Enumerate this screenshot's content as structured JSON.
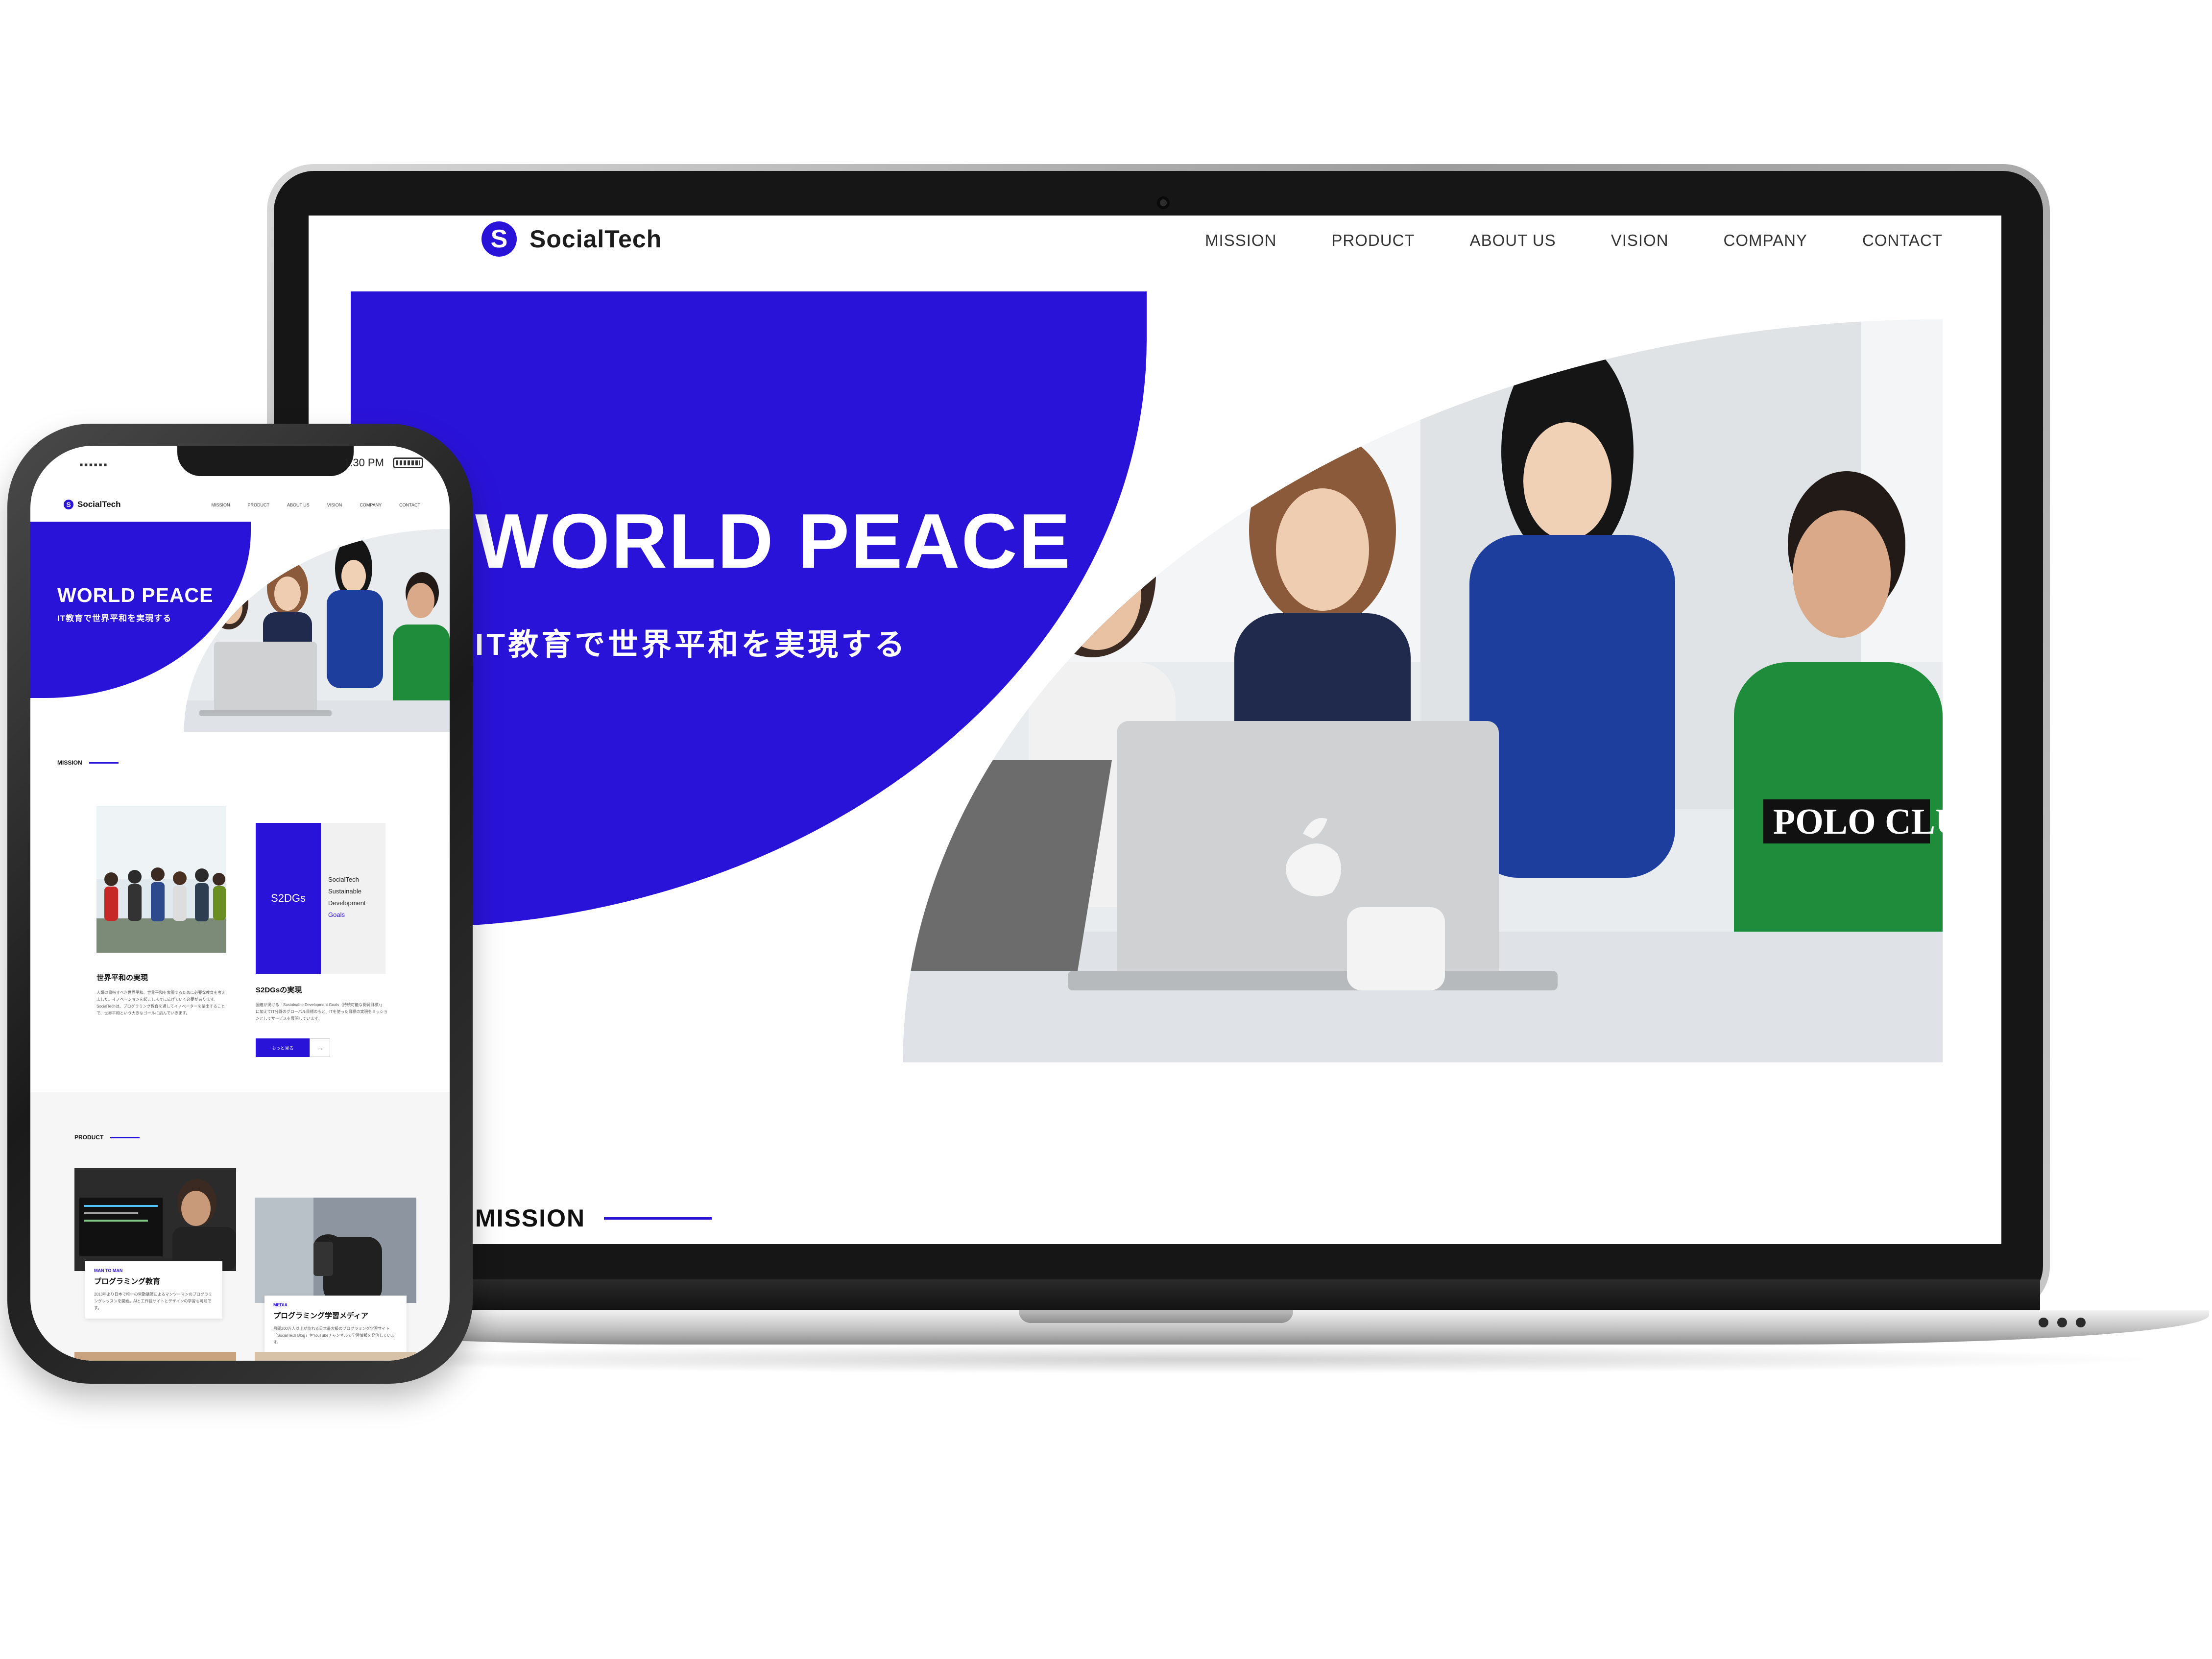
{
  "brand": {
    "name": "SocialTech",
    "logo_letter": "S",
    "accent_color": "#2a13d9"
  },
  "nav": {
    "items": [
      "MISSION",
      "PRODUCT",
      "ABOUT US",
      "VISION",
      "COMPANY",
      "CONTACT"
    ]
  },
  "hero": {
    "title": "WORLD PEACE",
    "subtitle": "IT教育で世界平和を実現する"
  },
  "sections": {
    "mission": "MISSION",
    "product": "PRODUCT"
  },
  "phone": {
    "status_time": "1:30 PM",
    "status_signal": "▪▪▪▪▪▪",
    "mission_card_1": {
      "title": "世界平和の実現",
      "text": "人類の目指すべき世界平和。世界平和を実現するために必要な教育を考えました。イノベーションを起こし人々に広げていく必要があります。SocialTechは、プログラミング教育を通してイノベーターを輩出することで、世界平和という大きなゴールに挑んでいきます。"
    },
    "mission_card_2": {
      "badge": "S2DGs",
      "lines": [
        "SocialTech",
        "Sustainable",
        "Development",
        "Goals"
      ],
      "title": "S2DGsの実現",
      "text": "国連が掲げる「Sustainable Development Goals（持続可能な開発目標）」に加えてIT分野のグローバル目標のもと、ITを使った目標の実現をミッションとしてサービスを展開しています。",
      "button": "もっと見る",
      "arrow": "→"
    },
    "products": [
      {
        "tag": "MAN TO MAN",
        "title": "プログラミング教育",
        "text": "2013年より日本で唯一の常勤講師によるマンツーマンのプログラミングレッスンを開始。AIと工作技サイトとデザインの学習も可能です。"
      },
      {
        "tag": "MEDIA",
        "title": "プログラミング学習メディア",
        "text": "月間200万人以上が訪れる日本最大級のプログラミング学習サイト「SocialTech Blog」やYouTubeチャンネルで学習情報を発信しています。"
      }
    ]
  }
}
